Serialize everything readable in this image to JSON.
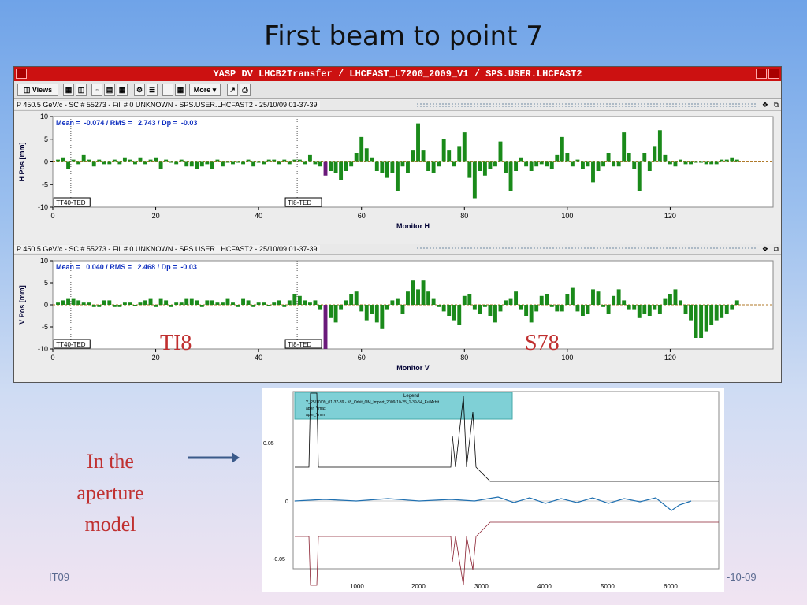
{
  "slide": {
    "title": "First beam to point 7",
    "footer_left": "IT09",
    "footer_right": "-10-09"
  },
  "window": {
    "title": "YASP DV LHCB2Transfer / LHCFAST_L7200_2009_V1 / SPS.USER.LHCFAST2",
    "toolbar": {
      "views": "Views",
      "more": "More"
    }
  },
  "panel_h": {
    "header": "P 450.5 GeV/c - SC # 55273 - Fill # 0 UNKNOWN - SPS.USER.LHCFAST2 - 25/10/09 01-37-39",
    "stats": "Mean =  -0.074 / RMS =   2.743 / Dp =  -0.03",
    "marker1": "TT40-TED",
    "marker2": "TI8-TED"
  },
  "panel_v": {
    "header": "P 450.5 GeV/c - SC # 55273 - Fill # 0 UNKNOWN - SPS.USER.LHCFAST2 - 25/10/09 01-37-39",
    "stats": "Mean =   0.040 / RMS =   2.468 / Dp =  -0.03",
    "marker1": "TT40-TED",
    "marker2": "TI8-TED"
  },
  "labels": {
    "ti8": "TI8",
    "s78": "S78",
    "aperture": [
      "In the",
      "aperture",
      "model"
    ]
  },
  "chart_data": [
    {
      "type": "bar",
      "xlabel": "Monitor H",
      "ylabel": "H Pos [mm]",
      "xlim": [
        0,
        140
      ],
      "ylim": [
        -10,
        10
      ],
      "xticks": [
        0,
        20,
        40,
        60,
        80,
        100,
        120
      ],
      "yticks": [
        -10,
        -5,
        0,
        5,
        10
      ],
      "bar_color": "#1a8a1a",
      "highlight_color": "#6a1a7a",
      "highlight_index": 52,
      "values": [
        0.5,
        1,
        -1.5,
        0.5,
        -0.5,
        1.5,
        0.5,
        -1,
        0.5,
        -0.5,
        -0.5,
        0.5,
        -0.5,
        1,
        0.5,
        -0.5,
        1,
        -0.5,
        0.5,
        1,
        -1.5,
        0.5,
        0,
        -0.5,
        0.5,
        -1,
        -1,
        -1.5,
        -1,
        -0.5,
        -1.5,
        0.5,
        -1,
        0,
        -0.5,
        0,
        -0.5,
        0.5,
        -1,
        0,
        -0.5,
        0.5,
        0.5,
        -0.5,
        0.5,
        -0.5,
        0.5,
        0.5,
        -0.5,
        1.5,
        -0.5,
        -1,
        -3,
        -2,
        -2.5,
        -4,
        -2,
        -1,
        2,
        5.5,
        3,
        1,
        -2,
        -2.5,
        -3.5,
        -2.5,
        -6.5,
        -1,
        -2.5,
        2.5,
        8.5,
        2.5,
        -2,
        -2.5,
        -1,
        5,
        2.5,
        -1,
        3.5,
        6.5,
        -3.5,
        -8,
        -2,
        -3,
        -1.5,
        -1,
        4.5,
        -2.5,
        -6.5,
        -2,
        1,
        -1,
        -2,
        -1,
        -0.5,
        -1,
        -1.5,
        1.5,
        5.5,
        2,
        -1,
        0.5,
        -1.5,
        -1,
        -4.5,
        -2,
        -1,
        2,
        -1,
        -1,
        6.5,
        2,
        -1.5,
        -6.5,
        2,
        -2,
        3.5,
        7,
        1.5,
        -0.5,
        -1,
        0.5,
        -0.5,
        -0.5,
        0,
        0,
        -0.5,
        -0.5,
        -0.5,
        0.5,
        0.5,
        1,
        0.5
      ]
    },
    {
      "type": "bar",
      "xlabel": "Monitor V",
      "ylabel": "V Pos [mm]",
      "xlim": [
        0,
        140
      ],
      "ylim": [
        -10,
        10
      ],
      "xticks": [
        0,
        20,
        40,
        60,
        80,
        100,
        120
      ],
      "yticks": [
        -10,
        -5,
        0,
        5,
        10
      ],
      "bar_color": "#1a8a1a",
      "highlight_color": "#6a1a7a",
      "highlight_index": 52,
      "values": [
        0.5,
        1,
        1.5,
        1.5,
        1,
        0.5,
        0.5,
        -0.5,
        -0.5,
        1,
        1,
        -0.5,
        -0.5,
        0.5,
        0.5,
        0,
        0.5,
        1,
        1.5,
        -0.5,
        1.5,
        1,
        -0.5,
        0.5,
        0.5,
        1.5,
        1.5,
        1,
        -0.5,
        1,
        1,
        0.5,
        0.5,
        1.5,
        0.5,
        -0.5,
        1.5,
        1,
        -0.5,
        0.5,
        0.5,
        0,
        0.5,
        1,
        -0.5,
        1,
        2.5,
        2,
        1,
        0.5,
        1,
        -1,
        -10,
        -3,
        -4,
        -1,
        1,
        2.5,
        3,
        -1.5,
        -3.5,
        -2,
        -4,
        -5.5,
        -1,
        1,
        1.5,
        -2,
        3,
        5.5,
        3.5,
        5.5,
        3,
        1.5,
        -0.5,
        -1.5,
        -2.5,
        -3.5,
        -4.5,
        2,
        2.5,
        -1,
        -2,
        -0.5,
        -2.5,
        -4,
        -1.5,
        1,
        1.5,
        3,
        -1,
        -2.5,
        -4,
        -1.5,
        2,
        2.5,
        -0.5,
        -1.5,
        -1.5,
        2.5,
        4,
        -1.5,
        -2.5,
        -2,
        3.5,
        3,
        -0.5,
        -2,
        2,
        3.5,
        1,
        -1,
        -1,
        -3,
        -2,
        -2.5,
        -1,
        -2,
        1.5,
        2.5,
        3.5,
        1,
        -2,
        -3.5,
        -7.5,
        -7.5,
        -6,
        -4.5,
        -3.5,
        -3,
        -2,
        -1,
        1
      ]
    }
  ]
}
